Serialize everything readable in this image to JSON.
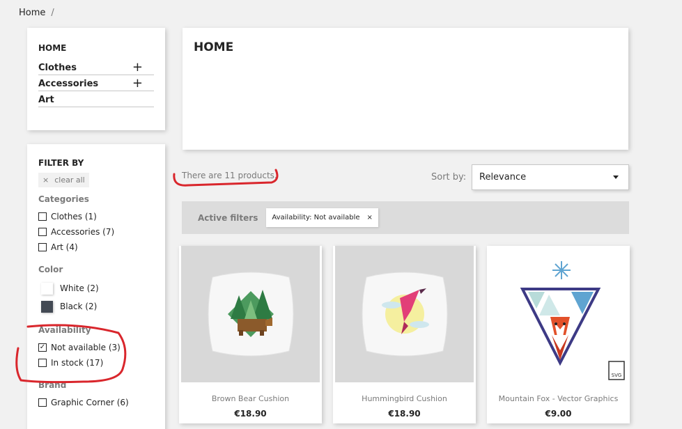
{
  "breadcrumb": {
    "home": "Home",
    "separator": "/"
  },
  "categories_block": {
    "title": "HOME",
    "items": [
      {
        "label": "Clothes",
        "expand": "+"
      },
      {
        "label": "Accessories",
        "expand": "+"
      },
      {
        "label": "Art",
        "expand": ""
      }
    ]
  },
  "filters": {
    "title": "FILTER BY",
    "clear_all": "clear all",
    "clear_icon": "×",
    "categories": {
      "title": "Categories",
      "options": [
        {
          "label": "Clothes (1)",
          "checked": false
        },
        {
          "label": "Accessories (7)",
          "checked": false
        },
        {
          "label": "Art (4)",
          "checked": false
        }
      ]
    },
    "color": {
      "title": "Color",
      "options": [
        {
          "label": "White (2)",
          "swatch": "#ffffff"
        },
        {
          "label": "Black (2)",
          "swatch": "#434a54"
        }
      ]
    },
    "availability": {
      "title": "Availability",
      "options": [
        {
          "label": "Not available (3)",
          "checked": true,
          "mark": "✓"
        },
        {
          "label": "In stock (17)",
          "checked": false,
          "mark": ""
        }
      ]
    },
    "brand": {
      "title": "Brand",
      "options": [
        {
          "label": "Graphic Corner (6)",
          "checked": false
        }
      ]
    }
  },
  "header": {
    "title": "HOME"
  },
  "listing": {
    "count_text": "There are 11 products.",
    "sort_label": "Sort by:",
    "sort_value": "Relevance",
    "active_filters_label": "Active filters",
    "active_filter_chip": "Availability: Not available",
    "chip_close": "×"
  },
  "products": [
    {
      "name": "Brown Bear Cushion",
      "price": "€18.90",
      "image": "bear-cushion"
    },
    {
      "name": "Hummingbird Cushion",
      "price": "€18.90",
      "image": "hummingbird-cushion"
    },
    {
      "name": "Mountain Fox - Vector Graphics",
      "price": "€9.00",
      "image": "mountain-fox-graphic",
      "badge": "SVG"
    }
  ],
  "colors": {
    "annotation": "#d9262c",
    "background": "#f1f1f1",
    "text": "#232323",
    "muted": "#7a7a7a"
  }
}
